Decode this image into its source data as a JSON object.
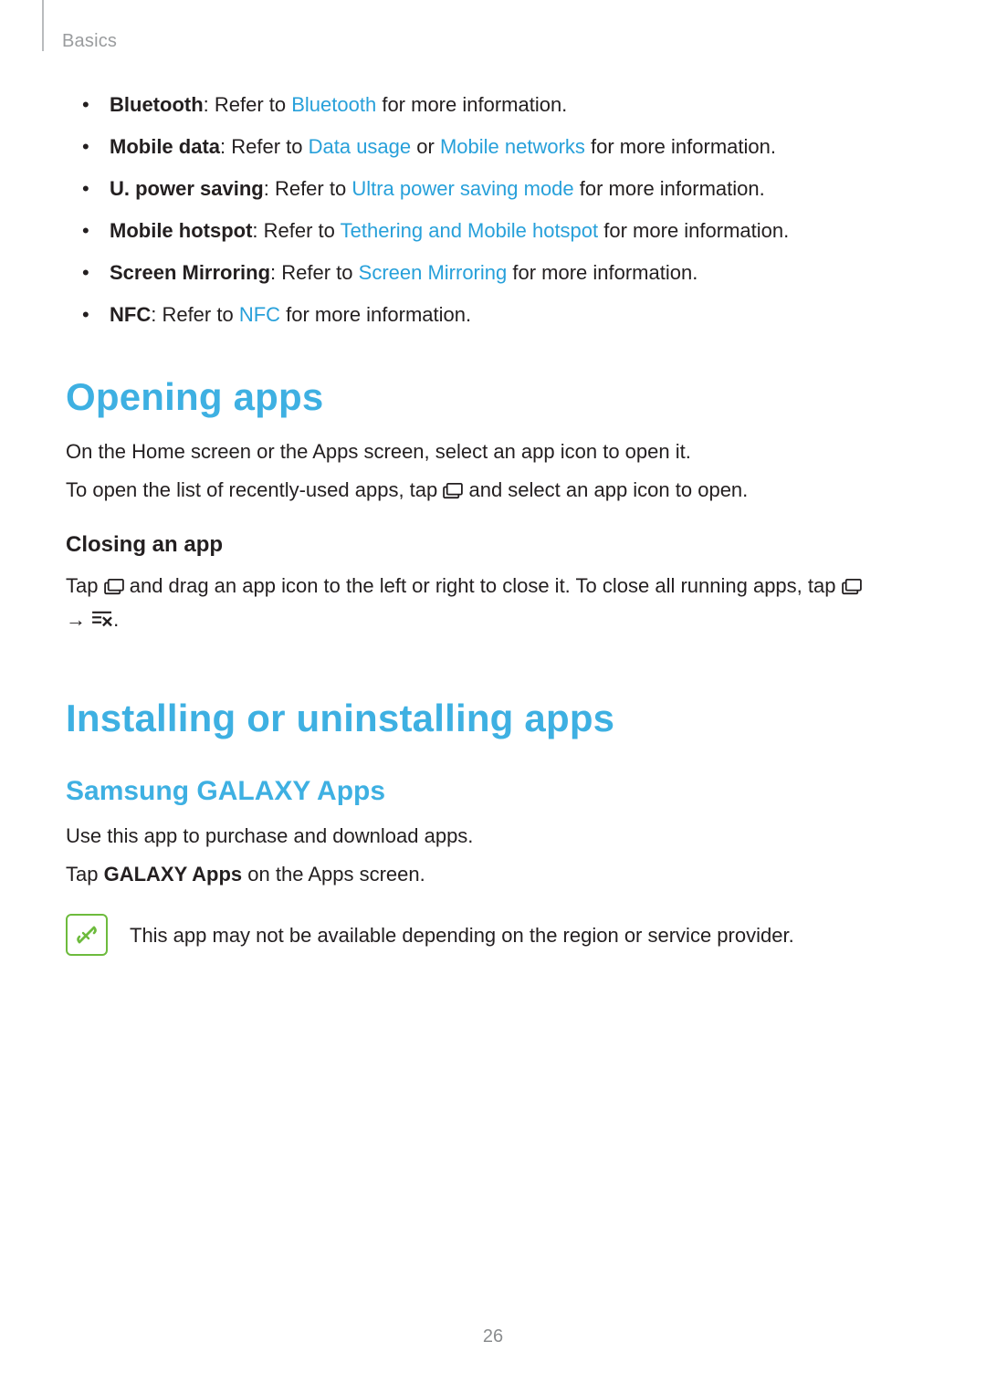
{
  "header": {
    "section": "Basics"
  },
  "features": [
    {
      "term": "Bluetooth",
      "pre": ": Refer to ",
      "links": [
        {
          "text": "Bluetooth"
        }
      ],
      "post": " for more information."
    },
    {
      "term": "Mobile data",
      "pre": ": Refer to ",
      "links": [
        {
          "text": "Data usage"
        }
      ],
      "join": " or ",
      "links2": [
        {
          "text": "Mobile networks"
        }
      ],
      "post": " for more information."
    },
    {
      "term": "U. power saving",
      "pre": ": Refer to ",
      "links": [
        {
          "text": "Ultra power saving mode"
        }
      ],
      "post": " for more information."
    },
    {
      "term": "Mobile hotspot",
      "pre": ": Refer to ",
      "links": [
        {
          "text": "Tethering and Mobile hotspot"
        }
      ],
      "post": " for more information."
    },
    {
      "term": "Screen Mirroring",
      "pre": ": Refer to ",
      "links": [
        {
          "text": "Screen Mirroring"
        }
      ],
      "post": " for more information."
    },
    {
      "term": "NFC",
      "pre": ": Refer to ",
      "links": [
        {
          "text": "NFC"
        }
      ],
      "post": " for more information."
    }
  ],
  "opening": {
    "title": "Opening apps",
    "p1": "On the Home screen or the Apps screen, select an app icon to open it.",
    "p2_pre": "To open the list of recently-used apps, tap ",
    "p2_post": " and select an app icon to open.",
    "closing_title": "Closing an app",
    "closing_pre": "Tap ",
    "closing_mid": " and drag an app icon to the left or right to close it. To close all running apps, tap ",
    "closing_arrow": " → ",
    "closing_end": "."
  },
  "installing": {
    "title": "Installing or uninstalling apps",
    "samsung_title": "Samsung GALAXY Apps",
    "p1": "Use this app to purchase and download apps.",
    "p2_pre": "Tap ",
    "p2_bold": "GALAXY Apps",
    "p2_post": " on the Apps screen.",
    "note": "This app may not be available depending on the region or service provider."
  },
  "page_number": "26"
}
